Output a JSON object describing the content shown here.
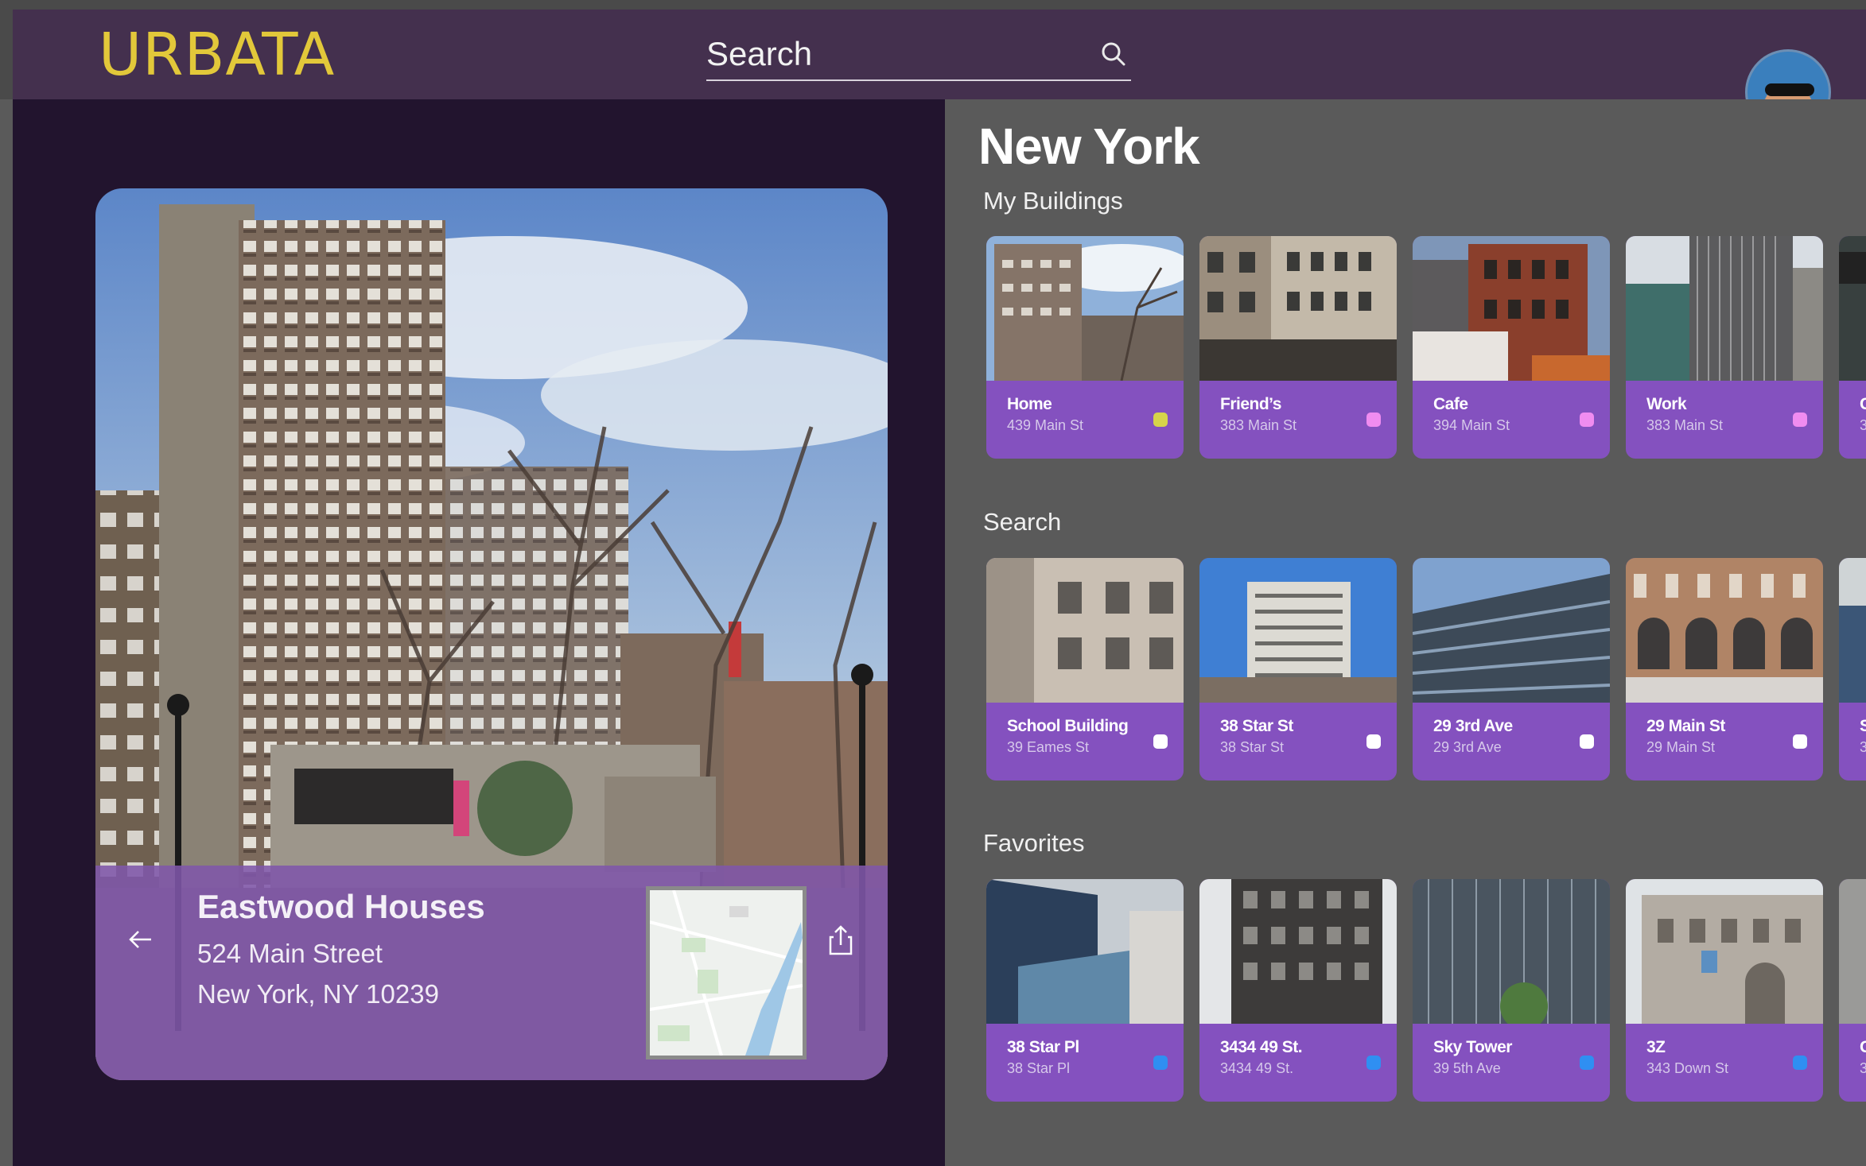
{
  "app": {
    "logo": "URBATA"
  },
  "search": {
    "placeholder": "Search",
    "value": "Search"
  },
  "feature": {
    "name": "Eastwood Houses",
    "street": "524 Main Street",
    "city": "New York, NY 10239"
  },
  "main": {
    "city": "New York",
    "sections": [
      {
        "title": "My Buildings",
        "tiles": [
          {
            "name": "Home",
            "address": "439 Main St",
            "dot_color": "#d6d44a"
          },
          {
            "name": "Friend’s",
            "address": "383 Main St",
            "dot_color": "#f08cf0"
          },
          {
            "name": "Cafe",
            "address": "394 Main St",
            "dot_color": "#f08cf0"
          },
          {
            "name": "Work",
            "address": "383 Main St",
            "dot_color": "#f08cf0"
          },
          {
            "name": "C",
            "address": "3",
            "dot_color": "#f08cf0"
          }
        ]
      },
      {
        "title": "Search",
        "tiles": [
          {
            "name": "School Building",
            "address": "39 Eames St",
            "dot_color": "#ffffff"
          },
          {
            "name": "38 Star St",
            "address": "38 Star St",
            "dot_color": "#ffffff"
          },
          {
            "name": "29 3rd Ave",
            "address": "29 3rd Ave",
            "dot_color": "#ffffff"
          },
          {
            "name": "29 Main St",
            "address": "29 Main St",
            "dot_color": "#ffffff"
          },
          {
            "name": "S",
            "address": "3",
            "dot_color": "#ffffff"
          }
        ]
      },
      {
        "title": "Favorites",
        "tiles": [
          {
            "name": "38 Star Pl",
            "address": "38 Star Pl",
            "dot_color": "#2f8ff2"
          },
          {
            "name": "3434 49 St.",
            "address": "3434 49 St.",
            "dot_color": "#2f8ff2"
          },
          {
            "name": "Sky Tower",
            "address": "39 5th Ave",
            "dot_color": "#2f8ff2"
          },
          {
            "name": "3Z",
            "address": "343 Down St",
            "dot_color": "#2f8ff2"
          },
          {
            "name": "C",
            "address": "3",
            "dot_color": "#2f8ff2"
          }
        ]
      }
    ]
  }
}
